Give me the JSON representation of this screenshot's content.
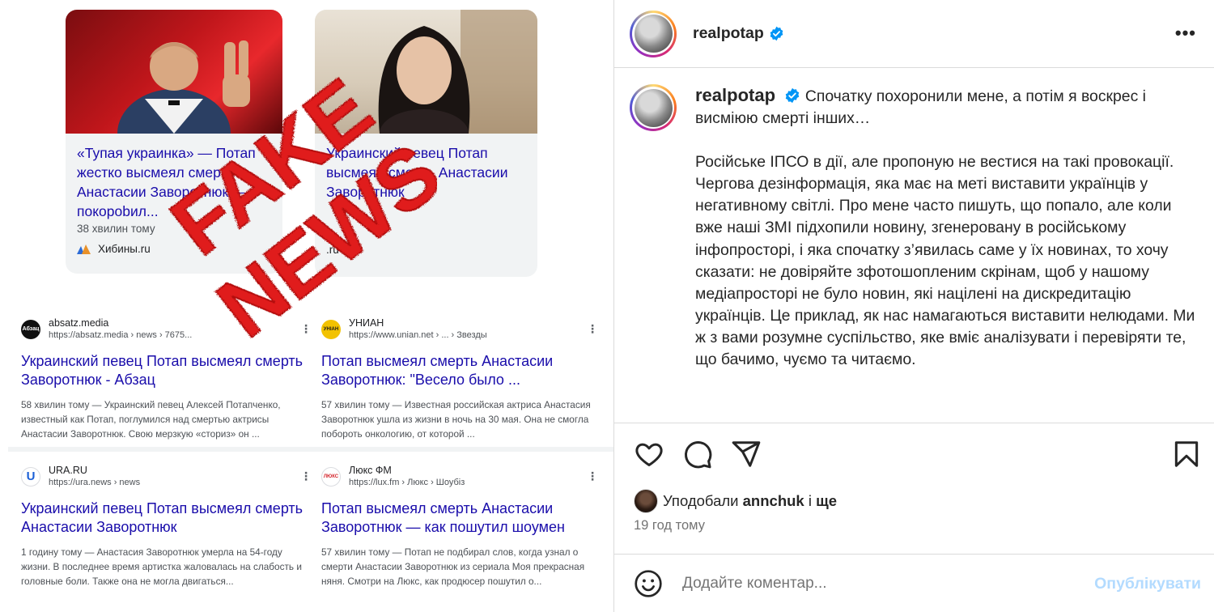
{
  "left": {
    "cards": [
      {
        "title": "«Тупая украинка» — Потап жестко высмеял смерть Анастасии Заворотнюк — покорobил...",
        "time": "38 хвилин тому",
        "source": "Хибины.ru"
      },
      {
        "title": "Украинский певец Потап высмеял смерть Анастасии Заворотнюк",
        "time": "",
        "source": ".ru"
      }
    ],
    "results": [
      {
        "site": "absatz.media",
        "url": "https://absatz.media › news › 7675...",
        "favicon_text": "Абзац",
        "title": "Украинский певец Потап высмеял смерть Заворотнюк - Абзац",
        "snippet": "58 хвилин тому — Украинский певец Алексей Потапченко, известный как Потап, поглумился над смертью актрисы Анастасии Заворотнюк. Свою мерзкую «сториз» он ..."
      },
      {
        "site": "УНИАН",
        "url": "https://www.unian.net › ... › Звезды",
        "favicon_text": "УНІАН",
        "title": "Потап высмеял смерть Анастасии Заворотнюк: \"Весело было ...",
        "snippet": "57 хвилин тому — Известная российская актриса Анастасия Заворотнюк ушла из жизни в ночь на 30 мая. Она не смогла побороть онкологию, от которой ..."
      },
      {
        "site": "URA.RU",
        "url": "https://ura.news › news",
        "favicon_text": "U",
        "title": "Украинский певец Потап высмеял смерть Анастасии Заворотнюк",
        "snippet": "1 годину тому — Анастасия Заворотнюк умерла на 54-году жизни. В последнее время артистка жаловалась на слабость и головные боли. Также она не могла двигаться..."
      },
      {
        "site": "Люкс ФМ",
        "url": "https://lux.fm › Люкс › Шоубіз",
        "favicon_text": "ЛЮКС",
        "title": "Потап высмеял смерть Анастасии Заворотнюк — как пошутил шоумен",
        "snippet": "57 хвилин тому — Потап не подбирал слов, когда узнал о смерти Анастасии Заворотнюк из сериала Моя прекрасная няня. Смотри на Люкс, как продюсер пошутил о..."
      }
    ],
    "stamp": {
      "line1": "FAKE",
      "line2": "NEWS",
      "color": "#e01b1b"
    }
  },
  "post": {
    "username": "realpotap",
    "caption_intro": "Спочатку похоронили мене, а потім я воскрес і висміюю смерті інших…",
    "caption_body": "Російське ІПСО в дії, але пропоную не вестися на такі провокації. Чергова дезінформація, яка має на меті виставити українців у негативному світлі. Про мене часто пишуть, що попало, але коли вже наші ЗМІ підхопили новину, згенеровану в російському інфопросторі, і яка спочатку з’явилась саме у їх новинах, то хочу сказати: не довіряйте зфотошопленим скрінам, щоб у нашому медіапросторі не було новин, які націлені на дискредитацію українців. Це приклад, як нас намагаються виставити нелюдами. Ми ж з вами розумне суспільство, яке вміє аналізувати і перевіряти те, що бачимо, чуємо та читаємо.",
    "likes_prefix": "Уподобали",
    "likes_user": "annchuk",
    "likes_and": "і",
    "likes_more": "ще",
    "time_ago": "19 год тому",
    "comment_placeholder": "Додайте коментар...",
    "publish_label": "Опублікувати",
    "colors": {
      "verified": "#0095f6",
      "publish_disabled": "#b3dbff"
    },
    "icons": [
      "heart-icon",
      "comment-icon",
      "share-icon",
      "bookmark-icon",
      "emoji-icon",
      "more-icon",
      "verified-icon"
    ]
  }
}
